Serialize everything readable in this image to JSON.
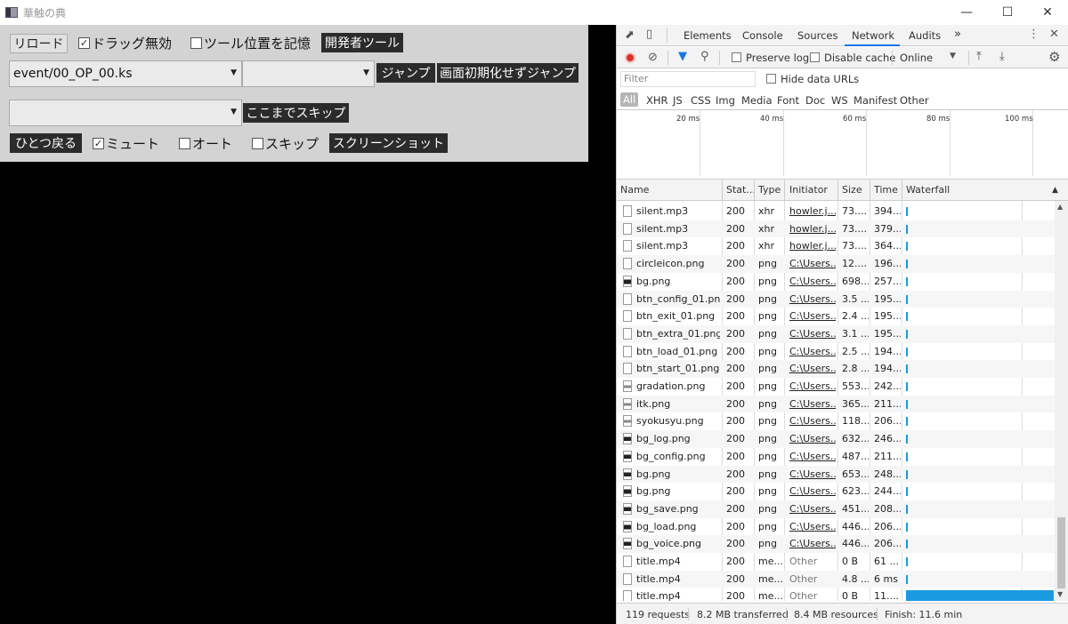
{
  "window": {
    "title": "華触の典"
  },
  "panel": {
    "reload": "リロード",
    "drag_disable": "ドラッグ無効",
    "remember_tool_pos": "ツール位置を記憶",
    "devtools": "開発者ツール",
    "scenario_select": "event/00_OP_00.ks",
    "label_select": "",
    "jump": "ジャンプ",
    "jump_no_reset": "画面初期化せずジャンプ",
    "skip_select": "",
    "skip_here": "ここまでスキップ",
    "back": "ひとつ戻る",
    "mute": "ミュート",
    "auto": "オート",
    "skip": "スキップ",
    "screenshot": "スクリーンショット"
  },
  "devtools": {
    "tabs": [
      "Elements",
      "Console",
      "Sources",
      "Network",
      "Audits"
    ],
    "more": "»",
    "toolbar": {
      "preserve_log": "Preserve log",
      "disable_cache": "Disable cache",
      "online": "Online"
    },
    "filter_placeholder": "Filter",
    "hide_data_urls": "Hide data URLs",
    "types": [
      "All",
      "XHR",
      "JS",
      "CSS",
      "Img",
      "Media",
      "Font",
      "Doc",
      "WS",
      "Manifest",
      "Other"
    ],
    "overview_ticks": [
      "20 ms",
      "40 ms",
      "60 ms",
      "80 ms",
      "100 ms"
    ],
    "columns": [
      "Name",
      "Stat...",
      "Type",
      "Initiator",
      "Size",
      "Time",
      "Waterfall"
    ],
    "rows": [
      {
        "name": "silent.mp3",
        "status": "200",
        "type": "xhr",
        "initiator": "howler.j...",
        "size": "73....",
        "time": "394...",
        "icon": "doc"
      },
      {
        "name": "silent.mp3",
        "status": "200",
        "type": "xhr",
        "initiator": "howler.j...",
        "size": "73....",
        "time": "379...",
        "icon": "doc"
      },
      {
        "name": "silent.mp3",
        "status": "200",
        "type": "xhr",
        "initiator": "howler.j...",
        "size": "73....",
        "time": "364...",
        "icon": "doc"
      },
      {
        "name": "circleicon.png",
        "status": "200",
        "type": "png",
        "initiator": "C:\\Users...",
        "size": "12....",
        "time": "196...",
        "icon": "doc"
      },
      {
        "name": "bg.png",
        "status": "200",
        "type": "png",
        "initiator": "C:\\Users...",
        "size": "698...",
        "time": "257...",
        "icon": "img"
      },
      {
        "name": "btn_config_01.png",
        "status": "200",
        "type": "png",
        "initiator": "C:\\Users...",
        "size": "3.5 ...",
        "time": "195...",
        "icon": "doc"
      },
      {
        "name": "btn_exit_01.png",
        "status": "200",
        "type": "png",
        "initiator": "C:\\Users...",
        "size": "2.4 ...",
        "time": "195...",
        "icon": "doc"
      },
      {
        "name": "btn_extra_01.png",
        "status": "200",
        "type": "png",
        "initiator": "C:\\Users...",
        "size": "3.1 ...",
        "time": "195...",
        "icon": "doc"
      },
      {
        "name": "btn_load_01.png",
        "status": "200",
        "type": "png",
        "initiator": "C:\\Users...",
        "size": "2.5 ...",
        "time": "194...",
        "icon": "doc"
      },
      {
        "name": "btn_start_01.png",
        "status": "200",
        "type": "png",
        "initiator": "C:\\Users...",
        "size": "2.8 ...",
        "time": "194...",
        "icon": "doc"
      },
      {
        "name": "gradation.png",
        "status": "200",
        "type": "png",
        "initiator": "C:\\Users...",
        "size": "553...",
        "time": "242...",
        "icon": "pic"
      },
      {
        "name": "itk.png",
        "status": "200",
        "type": "png",
        "initiator": "C:\\Users...",
        "size": "365...",
        "time": "211...",
        "icon": "pic"
      },
      {
        "name": "syokusyu.png",
        "status": "200",
        "type": "png",
        "initiator": "C:\\Users...",
        "size": "118...",
        "time": "206...",
        "icon": "pic"
      },
      {
        "name": "bg_log.png",
        "status": "200",
        "type": "png",
        "initiator": "C:\\Users...",
        "size": "632...",
        "time": "246...",
        "icon": "img"
      },
      {
        "name": "bg_config.png",
        "status": "200",
        "type": "png",
        "initiator": "C:\\Users...",
        "size": "487...",
        "time": "211...",
        "icon": "img"
      },
      {
        "name": "bg.png",
        "status": "200",
        "type": "png",
        "initiator": "C:\\Users...",
        "size": "653...",
        "time": "248...",
        "icon": "img"
      },
      {
        "name": "bg.png",
        "status": "200",
        "type": "png",
        "initiator": "C:\\Users...",
        "size": "623...",
        "time": "244...",
        "icon": "img"
      },
      {
        "name": "bg_save.png",
        "status": "200",
        "type": "png",
        "initiator": "C:\\Users...",
        "size": "451...",
        "time": "208...",
        "icon": "img"
      },
      {
        "name": "bg_load.png",
        "status": "200",
        "type": "png",
        "initiator": "C:\\Users...",
        "size": "446...",
        "time": "206...",
        "icon": "img"
      },
      {
        "name": "bg_voice.png",
        "status": "200",
        "type": "png",
        "initiator": "C:\\Users...",
        "size": "446...",
        "time": "206...",
        "icon": "img"
      },
      {
        "name": "title.mp4",
        "status": "200",
        "type": "me...",
        "initiator": "Other",
        "size": "0 B",
        "time": "61 ...",
        "icon": "doc"
      },
      {
        "name": "title.mp4",
        "status": "200",
        "type": "me...",
        "initiator": "Other",
        "size": "4.8 ...",
        "time": "6 ms",
        "icon": "doc"
      },
      {
        "name": "title.mp4",
        "status": "200",
        "type": "me...",
        "initiator": "Other",
        "size": "0 B",
        "time": "11....",
        "icon": "doc"
      }
    ],
    "status": {
      "requests": "119 requests",
      "transferred": "8.2 MB transferred",
      "resources": "8.4 MB resources",
      "finish": "Finish: 11.6 min"
    }
  }
}
